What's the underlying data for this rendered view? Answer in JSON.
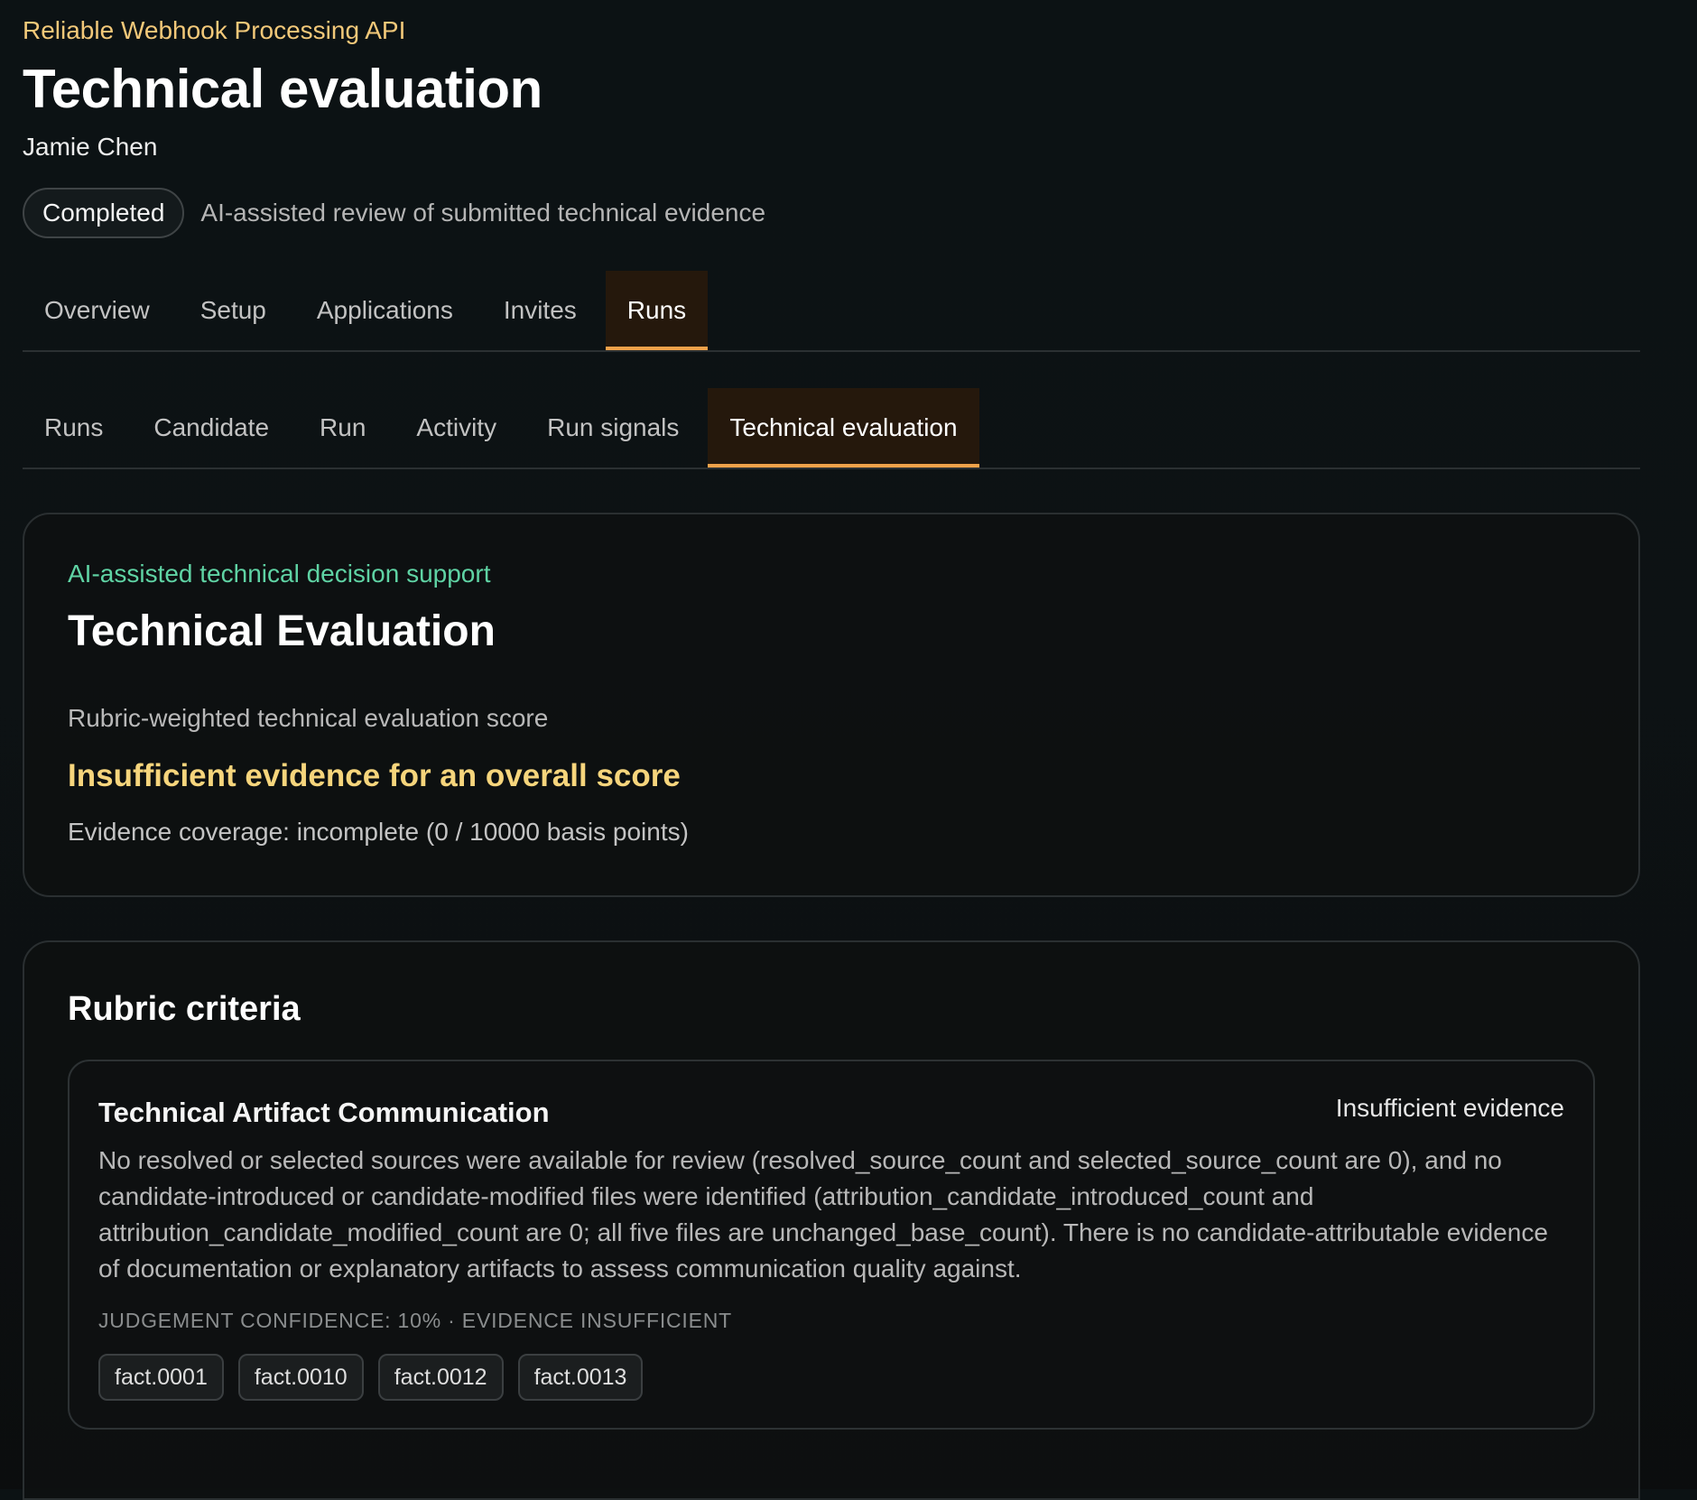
{
  "header": {
    "project": "Reliable Webhook Processing API",
    "title": "Technical evaluation",
    "person": "Jamie Chen",
    "status_badge": "Completed",
    "status_description": "AI-assisted review of submitted technical evidence"
  },
  "primary_tabs": [
    {
      "label": "Overview",
      "active": false
    },
    {
      "label": "Setup",
      "active": false
    },
    {
      "label": "Applications",
      "active": false
    },
    {
      "label": "Invites",
      "active": false
    },
    {
      "label": "Runs",
      "active": true
    }
  ],
  "secondary_tabs": [
    {
      "label": "Runs",
      "active": false
    },
    {
      "label": "Candidate",
      "active": false
    },
    {
      "label": "Run",
      "active": false
    },
    {
      "label": "Activity",
      "active": false
    },
    {
      "label": "Run signals",
      "active": false
    },
    {
      "label": "Technical evaluation",
      "active": true
    }
  ],
  "summary": {
    "eyebrow": "AI-assisted technical decision support",
    "title": "Technical Evaluation",
    "score_label": "Rubric-weighted technical evaluation score",
    "score_value": "Insufficient evidence for an overall score",
    "coverage": "Evidence coverage: incomplete (0 / 10000 basis points)"
  },
  "rubric": {
    "title": "Rubric criteria",
    "criteria": [
      {
        "name": "Technical Artifact Communication",
        "status": "Insufficient evidence",
        "body": "No resolved or selected sources were available for review (resolved_source_count and selected_source_count are 0), and no candidate-introduced or candidate-modified files were identified (attribution_candidate_introduced_count and attribution_candidate_modified_count are 0; all five files are unchanged_base_count). There is no candidate-attributable evidence of documentation or explanatory artifacts to assess communication quality against.",
        "confidence": "JUDGEMENT CONFIDENCE: 10% · EVIDENCE INSUFFICIENT",
        "facts": [
          "fact.0001",
          "fact.0010",
          "fact.0012",
          "fact.0013"
        ]
      }
    ]
  },
  "colors": {
    "background": "#0c1214",
    "project_accent": "#f2c879",
    "active_tab_underline": "#f0a24a",
    "active_tab_background": "#25180c",
    "eyebrow_green": "#5fd3a4",
    "score_warning": "#f6d57c"
  }
}
